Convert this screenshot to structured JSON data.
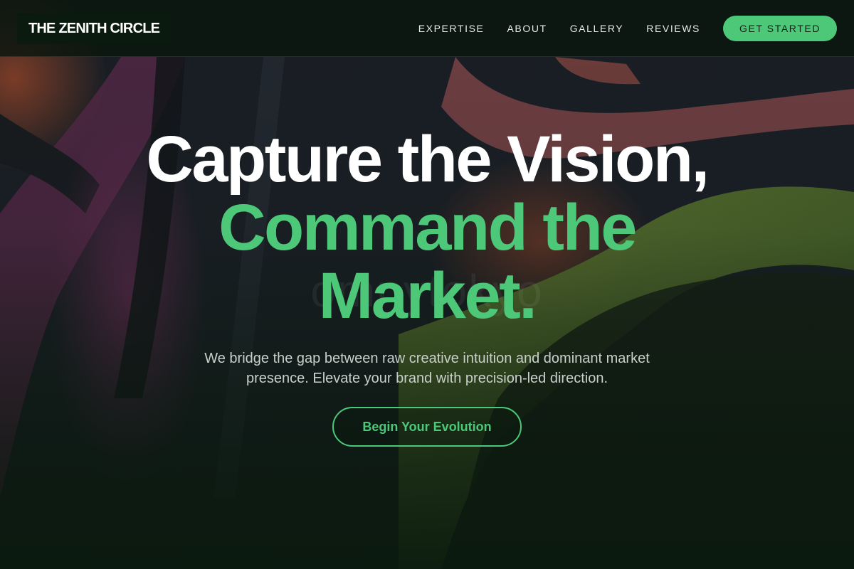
{
  "header": {
    "logo_text": "THE ZENITH CIRCLE",
    "nav": [
      {
        "label": "EXPERTISE"
      },
      {
        "label": "ABOUT"
      },
      {
        "label": "GALLERY"
      },
      {
        "label": "REVIEWS"
      }
    ],
    "cta_label": "GET STARTED"
  },
  "hero": {
    "headline_line1": "Capture the Vision,",
    "headline_line2": "Command the",
    "headline_line3": "Market.",
    "subheadline": "We bridge the gap between raw creative intuition and dominant market presence. Elevate your brand with precision-led direction.",
    "button_label": "Begin Your Evolution",
    "background_watermark": "omnytokyo"
  },
  "colors": {
    "accent": "#4cc878",
    "background": "#0b1a10",
    "headline_white": "#ffffff",
    "body_text": "#c9d0cb"
  }
}
